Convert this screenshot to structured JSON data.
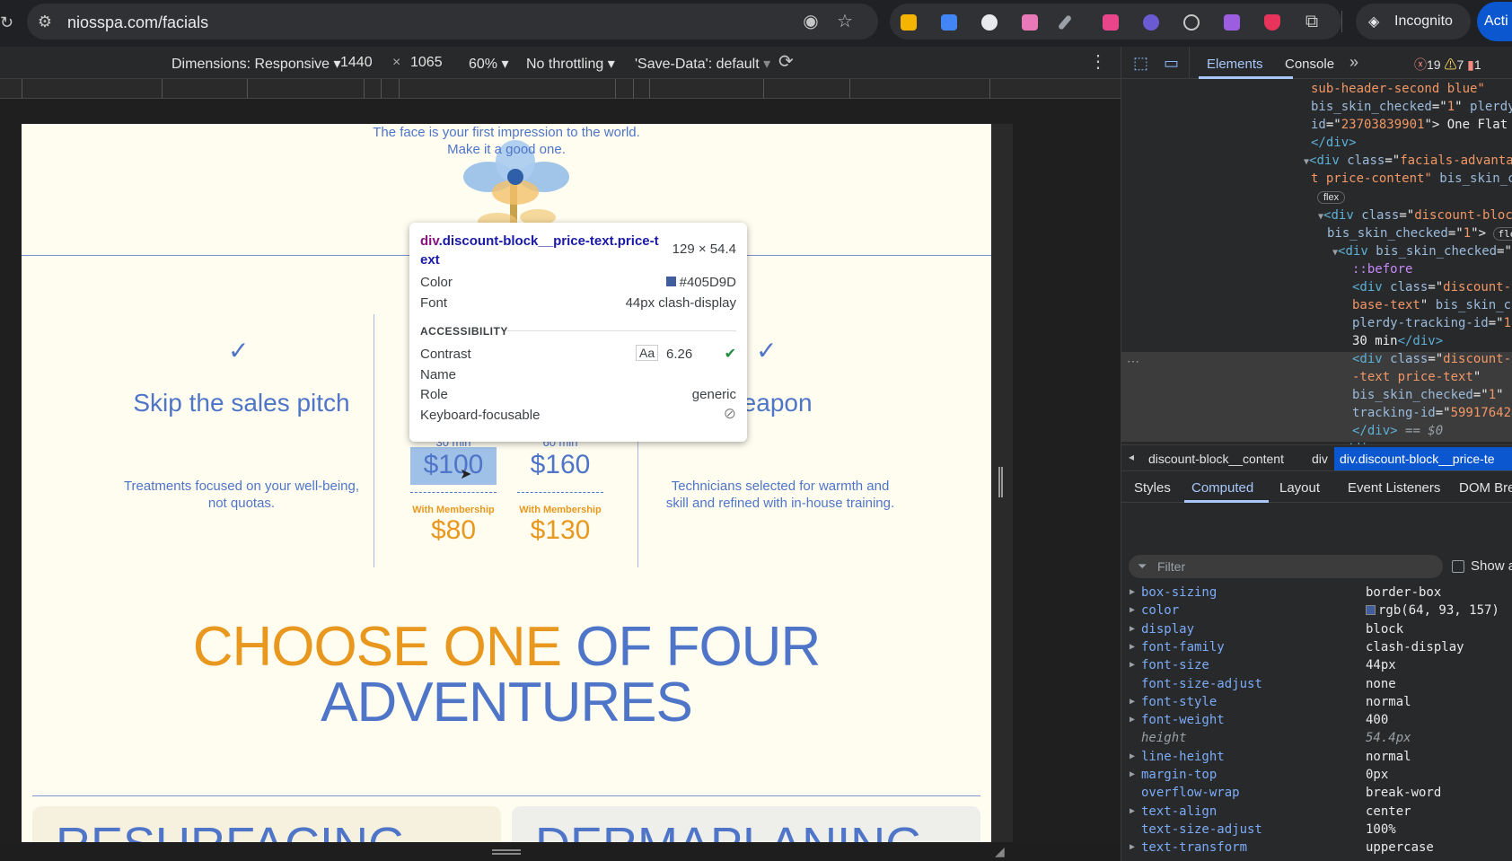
{
  "browser": {
    "url": "niosspa.com/facials",
    "incognito_label": "Incognito",
    "action_label": "Acti"
  },
  "device_toolbar": {
    "dimensions_label": "Dimensions: Responsive",
    "width": "1440",
    "times": "×",
    "height": "1065",
    "zoom": "60%",
    "throttling": "No throttling",
    "save_data": "'Save-Data': default"
  },
  "page": {
    "intro_line1": "The face is your first impression to the world.",
    "intro_line2": "Make it a good one.",
    "left_col": {
      "title": "Skip the sales pitch",
      "text_line1": "Treatments focused on your well-being,",
      "text_line2": "not quotas."
    },
    "right_col": {
      "title": "cret weapon",
      "text_line1": "Technicians selected for warmth and",
      "text_line2": "skill and refined with in-house training."
    },
    "prices": [
      {
        "duration": "30 min",
        "price": "$100",
        "member_label": "With Membership",
        "member_price": "$80"
      },
      {
        "duration": "60 min",
        "price": "$160",
        "member_label": "With Membership",
        "member_price": "$130"
      }
    ],
    "headline": {
      "orange": "CHOOSE ONE",
      "blue": "OF FOUR",
      "line2": "ADVENTURES"
    },
    "card1_title": "RESURFACING",
    "card2_title": "DERMAPLANING"
  },
  "tooltip": {
    "selector_tag": "div",
    "selector_class": ".discount-block__price-text.price-text",
    "size": "129 × 54.4",
    "color_label": "Color",
    "color_value": "#405D9D",
    "font_label": "Font",
    "font_value": "44px clash-display",
    "section": "ACCESSIBILITY",
    "contrast_label": "Contrast",
    "contrast_aa": "Aa",
    "contrast_value": "6.26",
    "name_label": "Name",
    "role_label": "Role",
    "role_value": "generic",
    "kbd_label": "Keyboard-focusable"
  },
  "devtools": {
    "tabs": [
      "Elements",
      "Console"
    ],
    "counts": {
      "errors": "19",
      "warnings": "7",
      "issues": "1"
    },
    "breadcrumb": [
      "discount-block__content",
      "div",
      "div.discount-block__price-te"
    ],
    "subtabs": [
      "Styles",
      "Computed",
      "Layout",
      "Event Listeners",
      "DOM Bre"
    ],
    "filter_placeholder": "Filter",
    "show_all": "Show a",
    "computed": [
      {
        "name": "box-sizing",
        "value": "border-box",
        "arrow": true
      },
      {
        "name": "color",
        "value": "rgb(64, 93, 157)",
        "arrow": true,
        "swatch": "#405D9D"
      },
      {
        "name": "display",
        "value": "block",
        "arrow": true
      },
      {
        "name": "font-family",
        "value": "clash-display",
        "arrow": true
      },
      {
        "name": "font-size",
        "value": "44px",
        "arrow": true
      },
      {
        "name": "font-size-adjust",
        "value": "none",
        "arrow": false
      },
      {
        "name": "font-style",
        "value": "normal",
        "arrow": true
      },
      {
        "name": "font-weight",
        "value": "400",
        "arrow": true
      },
      {
        "name": "height",
        "value": "54.4px",
        "arrow": false,
        "inherited": true
      },
      {
        "name": "line-height",
        "value": "normal",
        "arrow": true
      },
      {
        "name": "margin-top",
        "value": "0px",
        "arrow": true
      },
      {
        "name": "overflow-wrap",
        "value": "break-word",
        "arrow": false
      },
      {
        "name": "text-align",
        "value": "center",
        "arrow": true
      },
      {
        "name": "text-size-adjust",
        "value": "100%",
        "arrow": false
      },
      {
        "name": "text-transform",
        "value": "uppercase",
        "arrow": true
      }
    ]
  },
  "colors": {
    "blue": "#4f75c8",
    "orange": "#e8981e",
    "page_bg": "#fffdf0",
    "highlight": "#9fc1e8"
  }
}
